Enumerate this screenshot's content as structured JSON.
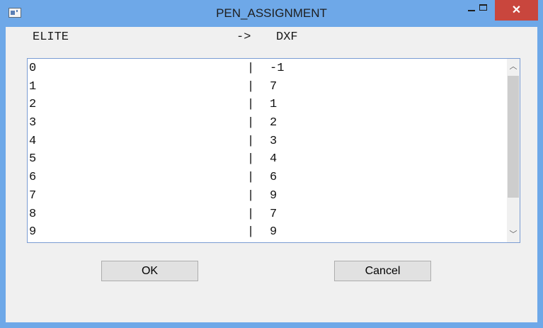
{
  "window": {
    "title": "PEN_ASSIGNMENT",
    "close_glyph": "✕",
    "icon": "app-icon"
  },
  "header": {
    "left": "ELITE",
    "arrow": "->",
    "right": "DXF"
  },
  "list": {
    "separator": "|",
    "rows": [
      {
        "elite": "0",
        "dxf": "-1"
      },
      {
        "elite": "1",
        "dxf": "7"
      },
      {
        "elite": "2",
        "dxf": "1"
      },
      {
        "elite": "3",
        "dxf": "2"
      },
      {
        "elite": "4",
        "dxf": "3"
      },
      {
        "elite": "5",
        "dxf": "4"
      },
      {
        "elite": "6",
        "dxf": "6"
      },
      {
        "elite": "7",
        "dxf": "9"
      },
      {
        "elite": "8",
        "dxf": "7"
      },
      {
        "elite": "9",
        "dxf": "9"
      }
    ]
  },
  "scrollbar": {
    "up_glyph": "︿",
    "down_glyph": "﹀"
  },
  "buttons": {
    "ok": "OK",
    "cancel": "Cancel"
  },
  "colors": {
    "titlebar": "#6ea8e8",
    "close": "#c9463d",
    "list_border": "#7a9cd3"
  }
}
